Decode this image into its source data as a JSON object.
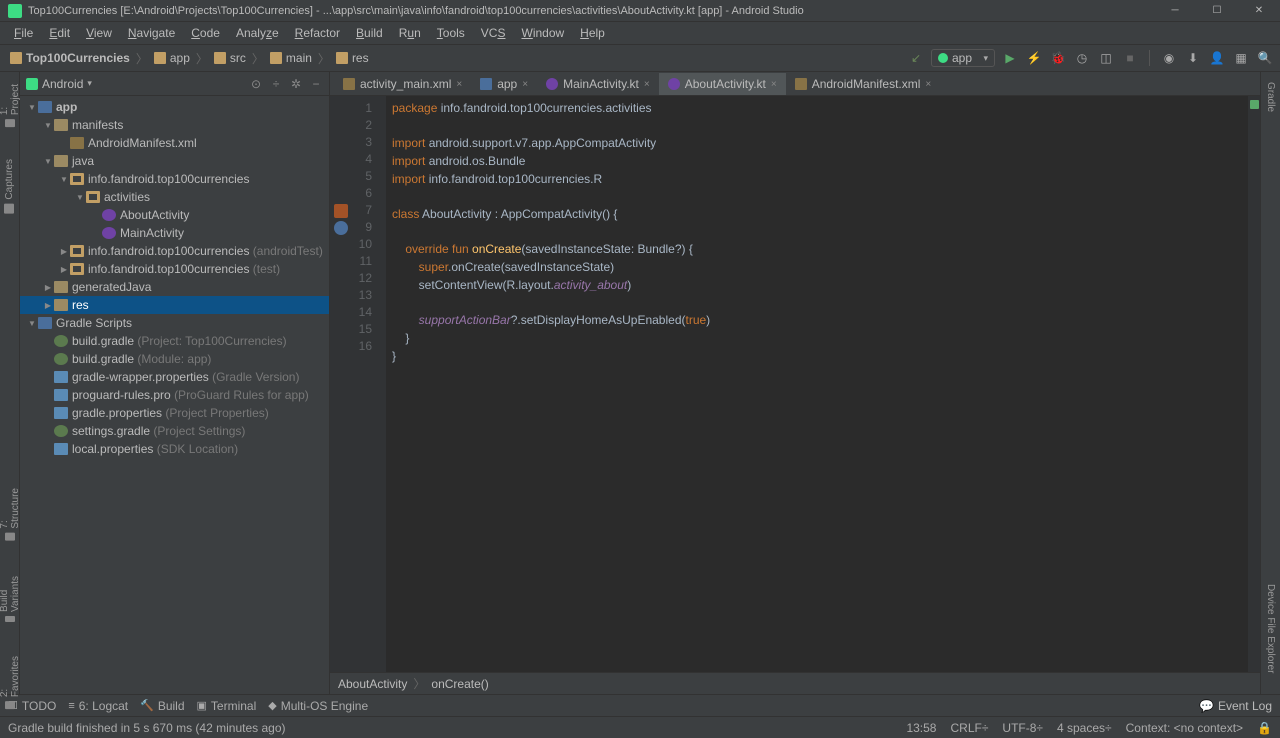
{
  "title": "Top100Currencies [E:\\Android\\Projects\\Top100Currencies] - ...\\app\\src\\main\\java\\info\\fandroid\\top100currencies\\activities\\AboutActivity.kt [app] - Android Studio",
  "menu": [
    "File",
    "Edit",
    "View",
    "Navigate",
    "Code",
    "Analyze",
    "Refactor",
    "Build",
    "Run",
    "Tools",
    "VCS",
    "Window",
    "Help"
  ],
  "breadcrumbs": [
    "Top100Currencies",
    "app",
    "src",
    "main",
    "res"
  ],
  "runConfig": "app",
  "projectView": "Android",
  "tree": {
    "app": "app",
    "manifests": "manifests",
    "manifestFile": "AndroidManifest.xml",
    "java": "java",
    "mainPkg": "info.fandroid.top100currencies",
    "activities": "activities",
    "about": "AboutActivity",
    "mainAct": "MainActivity",
    "androidTest": "info.fandroid.top100currencies",
    "androidTestDim": "(androidTest)",
    "test": "info.fandroid.top100currencies",
    "testDim": "(test)",
    "genJava": "generatedJava",
    "res": "res",
    "gradle": "Gradle Scripts",
    "g1": "build.gradle",
    "g1d": "(Project: Top100Currencies)",
    "g2": "build.gradle",
    "g2d": "(Module: app)",
    "g3": "gradle-wrapper.properties",
    "g3d": "(Gradle Version)",
    "g4": "proguard-rules.pro",
    "g4d": "(ProGuard Rules for app)",
    "g5": "gradle.properties",
    "g5d": "(Project Properties)",
    "g6": "settings.gradle",
    "g6d": "(Project Settings)",
    "g7": "local.properties",
    "g7d": "(SDK Location)"
  },
  "tabs": [
    "activity_main.xml",
    "app",
    "MainActivity.kt",
    "AboutActivity.kt",
    "AndroidManifest.xml"
  ],
  "activeTab": 3,
  "gutters": [
    "1",
    "2",
    "3",
    "4",
    "5",
    "6",
    "7",
    "",
    "9",
    "10",
    "11",
    "12",
    "13",
    "14",
    "15",
    "16"
  ],
  "code": {
    "l1p": "package ",
    "l1": "info.fandroid.top100currencies.activities",
    "imp": "import ",
    "i1": "android.support.v7.app.AppCompatActivity",
    "i2": "android.os.Bundle",
    "i3": "info.fandroid.top100currencies.R",
    "cls": "class ",
    "clsn": "AboutActivity",
    "ext": " : AppCompatActivity() {",
    "ov": "    override fun ",
    "oc": "onCreate",
    "oca": "(savedInstanceState: Bundle?) {",
    "sup": "        super",
    "supc": ".onCreate(savedInstanceState)",
    "scv": "        setContentView(R.layout.",
    "scva": "activity_about",
    "scvb": ")",
    "bar": "        supportActionBar",
    "barq": "?.setDisplayHomeAsUpEnabled(",
    "tru": "true",
    "barc": ")",
    "cb1": "    }",
    "cb2": "}"
  },
  "bc": {
    "a": "AboutActivity",
    "b": "onCreate()"
  },
  "bottom": [
    "TODO",
    "6: Logcat",
    "Build",
    "Terminal",
    "Multi-OS Engine"
  ],
  "eventLog": "Event Log",
  "status": "Gradle build finished in 5 s 670 ms (42 minutes ago)",
  "statusR": [
    "13:58",
    "CRLF÷",
    "UTF-8÷",
    "4 spaces÷",
    "Context: <no context>"
  ]
}
